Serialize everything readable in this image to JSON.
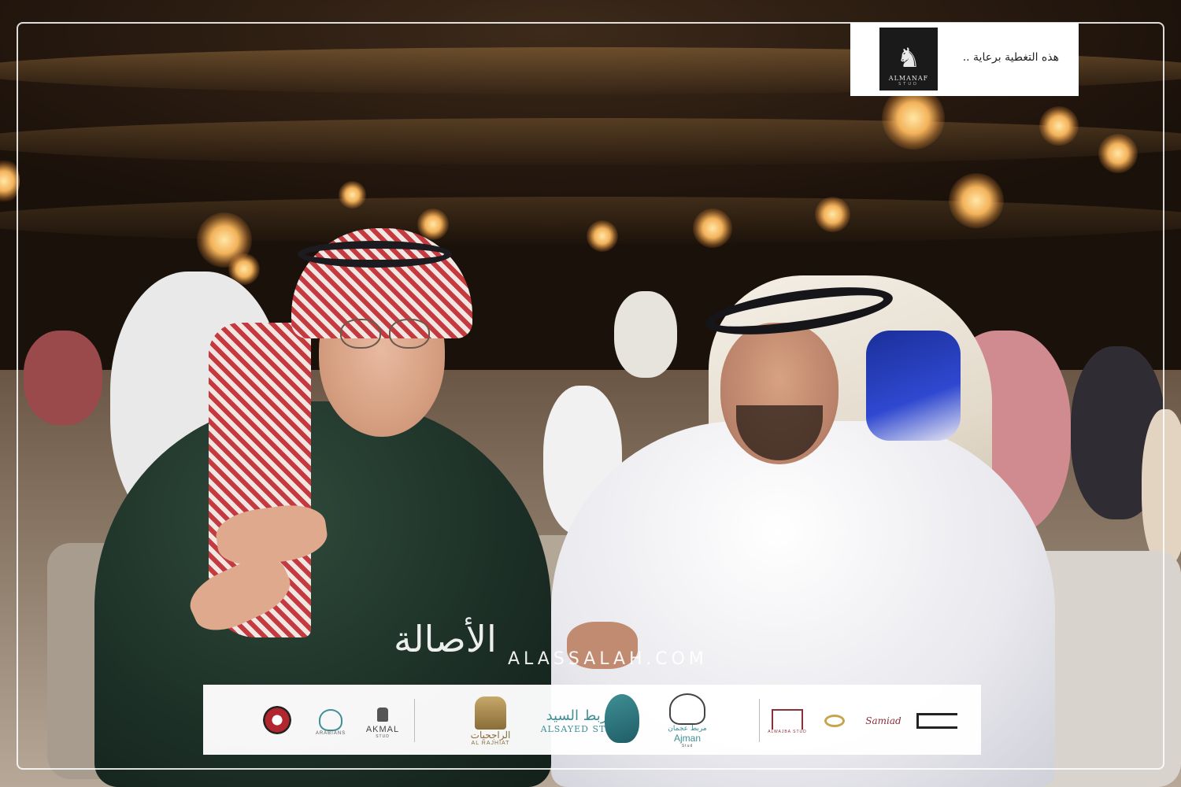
{
  "sponsor": {
    "caption": "هذه التغطية برعاية ..",
    "logo_name": "ALMANAF",
    "logo_sub": "STUD",
    "logo_mark": "♞"
  },
  "watermark": {
    "arabic": "الأصالة",
    "latin": "ALASSALAH.COM"
  },
  "strip": {
    "akmal": "AKMAL",
    "akmal_sub": "STUD",
    "arabians": "ARABIANS",
    "rajhiat_ar": "الراجحيات",
    "rajhiat_en": "AL RAJHIAT",
    "alsayed_ar": "مربط السيد",
    "alsayed_en": "ALSAYED STUD",
    "ajman_ar": "مربط عجمان",
    "ajman_en": "Ajman",
    "ajman_sub": "Stud",
    "alwajba": "ALWAJBA STUD",
    "samiad": "Samiad"
  },
  "colors": {
    "frame": "#ffffff",
    "strip_bg": "#ffffff",
    "teal": "#3f8f95",
    "gold": "#a6874d",
    "maroon": "#8b2f3b"
  }
}
